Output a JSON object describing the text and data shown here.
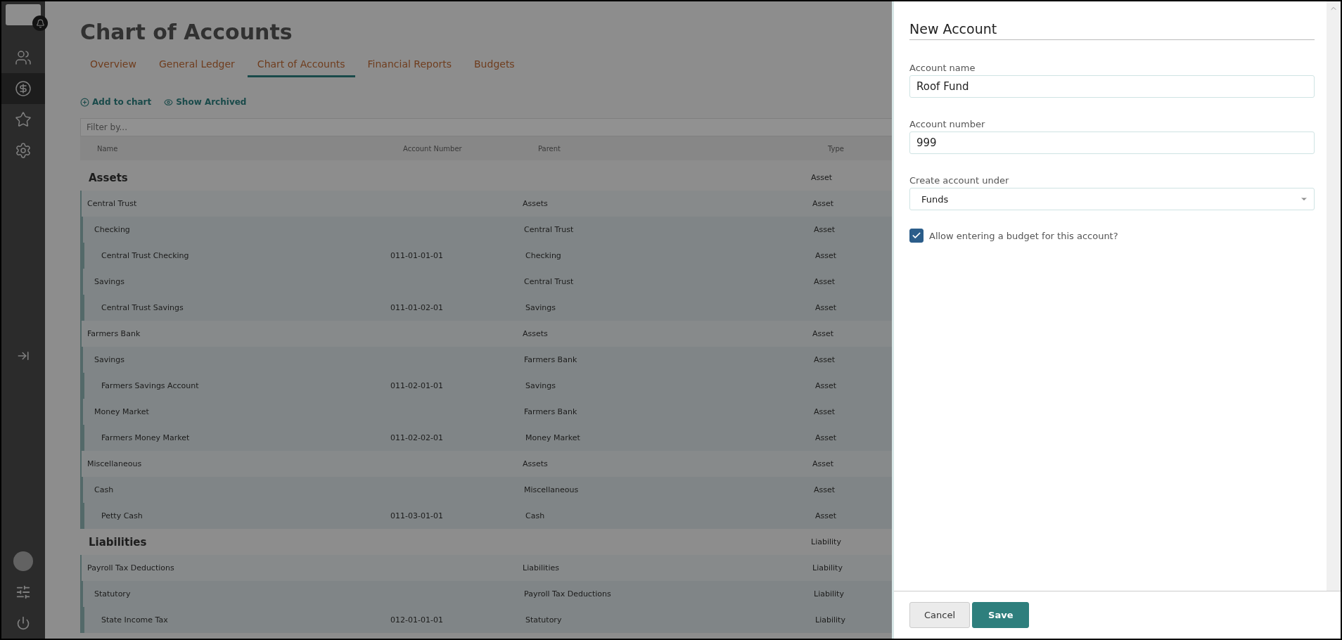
{
  "sidebar": {
    "items": [
      {
        "selected": false
      },
      {
        "selected": true
      },
      {
        "selected": false
      },
      {
        "selected": false
      }
    ]
  },
  "page": {
    "title": "Chart of Accounts"
  },
  "tabs": [
    {
      "label": "Overview",
      "selected": false
    },
    {
      "label": "General Ledger",
      "selected": false
    },
    {
      "label": "Chart of Accounts",
      "selected": true
    },
    {
      "label": "Financial Reports",
      "selected": false
    },
    {
      "label": "Budgets",
      "selected": false
    }
  ],
  "actions": [
    {
      "kind": "add",
      "label": "Add to chart"
    },
    {
      "kind": "view",
      "label": "Show Archived"
    }
  ],
  "filter": {
    "placeholder": "Filter by..."
  },
  "table": {
    "columns": [
      "Name",
      "Account Number",
      "Parent",
      "Type"
    ],
    "rows": [
      {
        "kind": "group",
        "name": "Assets",
        "type": "Asset",
        "children": [
          {
            "name": "Central Trust",
            "parent": "Assets",
            "type": "Asset",
            "children": [
              {
                "name": "Checking",
                "parent": "Central Trust",
                "type": "Asset",
                "children": [
                  {
                    "name": "Central Trust Checking",
                    "number": "011-01-01-01",
                    "parent": "Checking",
                    "type": "Asset"
                  }
                ]
              },
              {
                "name": "Savings",
                "parent": "Central Trust",
                "type": "Asset",
                "children": [
                  {
                    "name": "Central Trust Savings",
                    "number": "011-01-02-01",
                    "parent": "Savings",
                    "type": "Asset"
                  }
                ]
              }
            ]
          },
          {
            "name": "Farmers Bank",
            "parent": "Assets",
            "type": "Asset",
            "children": [
              {
                "name": "Savings",
                "parent": "Farmers Bank",
                "type": "Asset",
                "children": [
                  {
                    "name": "Farmers Savings Account",
                    "number": "011-02-01-01",
                    "parent": "Savings",
                    "type": "Asset"
                  }
                ]
              },
              {
                "name": "Money Market",
                "parent": "Farmers Bank",
                "type": "Asset",
                "children": [
                  {
                    "name": "Farmers Money Market",
                    "number": "011-02-02-01",
                    "parent": "Money Market",
                    "type": "Asset"
                  }
                ]
              }
            ]
          },
          {
            "name": "Miscellaneous",
            "parent": "Assets",
            "type": "Asset",
            "children": [
              {
                "name": "Cash",
                "parent": "Miscellaneous",
                "type": "Asset",
                "children": [
                  {
                    "name": "Petty Cash",
                    "number": "011-03-01-01",
                    "parent": "Cash",
                    "type": "Asset"
                  }
                ]
              }
            ]
          }
        ]
      },
      {
        "kind": "group",
        "name": "Liabilities",
        "type": "Liability",
        "children": [
          {
            "name": "Payroll Tax Deductions",
            "parent": "Liabilities",
            "type": "Liability",
            "children": [
              {
                "name": "Statutory",
                "parent": "Payroll Tax Deductions",
                "type": "Liability",
                "children": [
                  {
                    "name": "State Income Tax",
                    "number": "012-01-01-01",
                    "parent": "Statutory",
                    "type": "Liability"
                  }
                ]
              }
            ]
          }
        ]
      }
    ]
  },
  "drawer": {
    "title": "New Account",
    "fields": [
      {
        "kind": "text",
        "label": "Account name",
        "value": "Roof Fund"
      },
      {
        "kind": "text",
        "label": "Account number",
        "value": "999"
      },
      {
        "kind": "select",
        "label": "Create account under",
        "value": "Funds"
      }
    ],
    "checkbox": {
      "label": "Allow entering a budget for this account?",
      "checked": true
    },
    "buttons": [
      {
        "kind": "secondary",
        "label": "Cancel"
      },
      {
        "kind": "primary",
        "label": "Save"
      }
    ]
  }
}
